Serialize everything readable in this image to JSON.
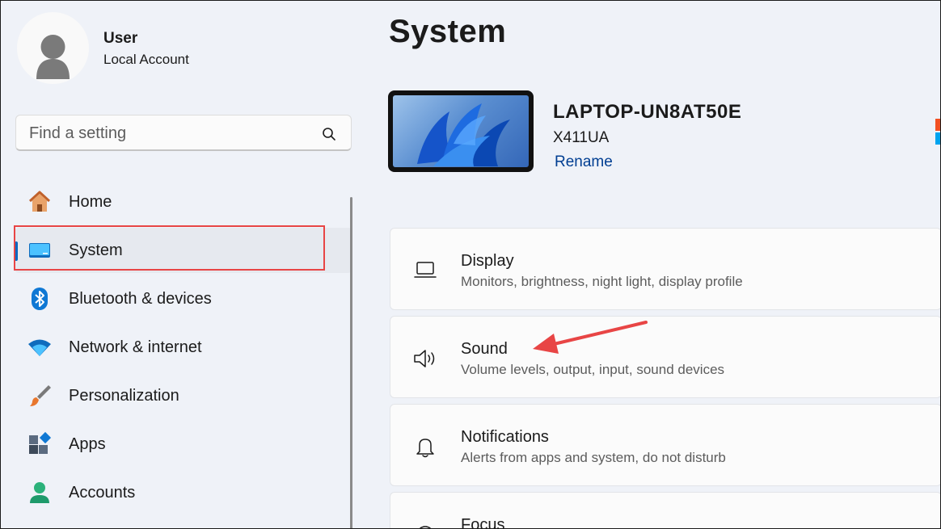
{
  "user": {
    "name": "User",
    "account_type": "Local Account"
  },
  "search": {
    "placeholder": "Find a setting"
  },
  "sidebar": {
    "items": [
      {
        "label": "Home",
        "icon": "home-icon"
      },
      {
        "label": "System",
        "icon": "system-icon",
        "active": true
      },
      {
        "label": "Bluetooth & devices",
        "icon": "bluetooth-icon"
      },
      {
        "label": "Network & internet",
        "icon": "wifi-icon"
      },
      {
        "label": "Personalization",
        "icon": "brush-icon"
      },
      {
        "label": "Apps",
        "icon": "apps-icon"
      },
      {
        "label": "Accounts",
        "icon": "account-icon"
      }
    ]
  },
  "main": {
    "title": "System",
    "device": {
      "name": "LAPTOP-UN8AT50E",
      "model": "X411UA",
      "rename_label": "Rename"
    },
    "cards": [
      {
        "title": "Display",
        "description": "Monitors, brightness, night light, display profile",
        "icon": "laptop-icon"
      },
      {
        "title": "Sound",
        "description": "Volume levels, output, input, sound devices",
        "icon": "speaker-icon"
      },
      {
        "title": "Notifications",
        "description": "Alerts from apps and system, do not disturb",
        "icon": "bell-icon"
      },
      {
        "title": "Focus",
        "description": "",
        "icon": "focus-icon"
      }
    ]
  },
  "colors": {
    "accent": "#0067c0",
    "highlight": "#e84545",
    "link": "#003e92",
    "background": "#eff2f8"
  }
}
